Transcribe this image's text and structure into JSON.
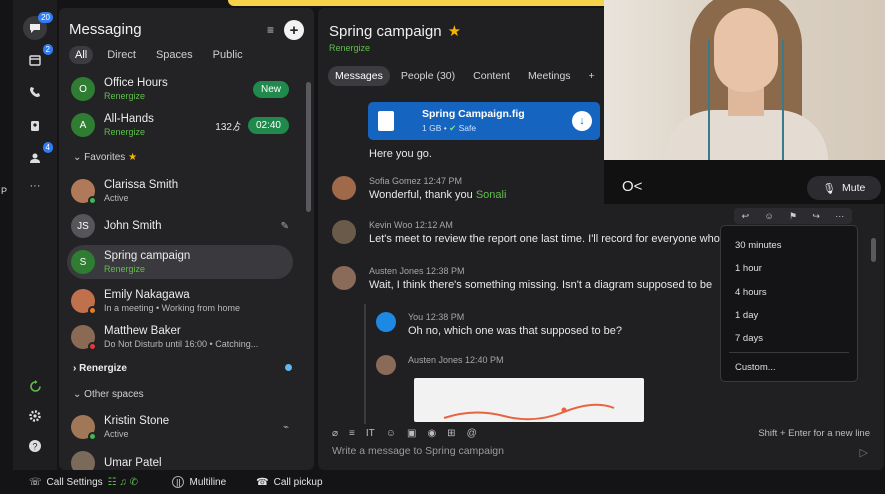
{
  "rail": {
    "chat_badge": "20",
    "calendar_badge": "2",
    "teams_badge": "4",
    "p_label": "P",
    "more": "···"
  },
  "spaces": {
    "title": "Messaging",
    "filters": [
      "All",
      "Direct",
      "Spaces",
      "Public"
    ],
    "items": [
      {
        "name": "Office Hours",
        "sub": "Renergize",
        "initial": "O",
        "color": "#2e7d32",
        "pill": "New"
      },
      {
        "name": "All-Hands",
        "sub": "Renergize",
        "initial": "A",
        "color": "#2e7d32",
        "time_left": "132ゟ",
        "pill": "02:40"
      }
    ],
    "favorites_label": "Favorites",
    "favorites": [
      {
        "name": "Clarissa Smith",
        "sub": "Active"
      },
      {
        "name": "John Smith",
        "initials": "JS"
      },
      {
        "name": "Spring campaign",
        "sub": "Renergize",
        "initial": "S"
      },
      {
        "name": "Emily Nakagawa",
        "sub": "In a meeting  •  Working from home"
      },
      {
        "name": "Matthew Baker",
        "sub": "Do Not Disturb until 16:00  •  Catching..."
      }
    ],
    "renergize_label": "Renergize",
    "other_label": "Other spaces",
    "others": [
      {
        "name": "Kristin Stone",
        "sub": "Active"
      },
      {
        "name": "Umar Patel"
      }
    ]
  },
  "conversation": {
    "title": "Spring campaign",
    "team": "Renergize",
    "tabs": [
      "Messages",
      "People (30)",
      "Content",
      "Meetings"
    ],
    "file": {
      "name": "Spring Campaign.fig",
      "size": "1 GB",
      "safe": "Safe"
    },
    "here_you_go": "Here you go.",
    "messages": [
      {
        "meta": "Sofia Gomez  12:47 PM",
        "body": "Wonderful, thank you ",
        "mention": "Sonali"
      },
      {
        "meta": "Kevin Woo  12:12 AM",
        "body": "Let's meet to review the report one last time. I'll record for everyone who"
      },
      {
        "meta": "Austen Jones  12:38 PM",
        "body": "Wait, I think there's something missing. Isn't a diagram supposed to be"
      }
    ],
    "thread": [
      {
        "meta": "You  12:38 PM",
        "body": "Oh no, which one was that supposed to be?"
      },
      {
        "meta": "Austen Jones  12:40 PM"
      }
    ],
    "compose_placeholder": "Write a message to Spring campaign",
    "compose_hint": "Shift + Enter for a new line"
  },
  "dropdown": {
    "options": [
      "30 minutes",
      "1 hour",
      "4 hours",
      "1 day",
      "7 days",
      "Custom..."
    ]
  },
  "video": {
    "mute_label": "Mute"
  },
  "bottom": {
    "call_settings": "Call Settings",
    "multiline": "Multiline",
    "call_pickup": "Call pickup"
  }
}
